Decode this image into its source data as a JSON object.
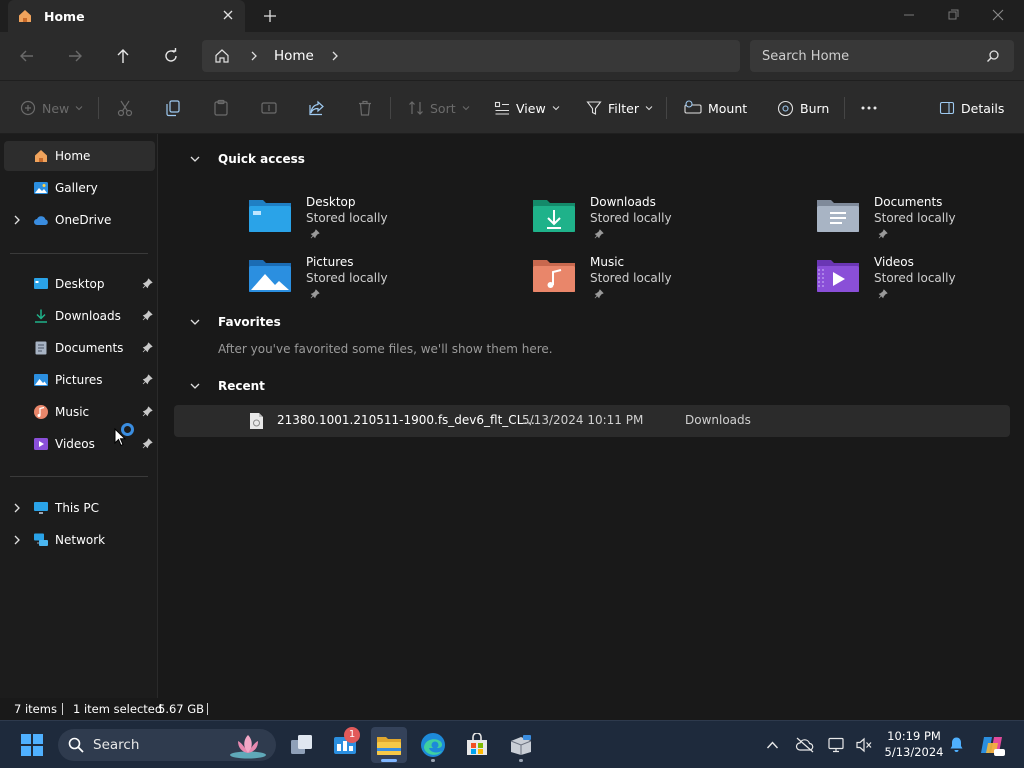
{
  "window": {
    "tab_label": "Home",
    "minimize": "Minimize",
    "maximize": "Maximize",
    "close": "Close"
  },
  "address": {
    "breadcrumb": "Home",
    "search_placeholder": "Search Home"
  },
  "toolbar": {
    "new_label": "New",
    "sort_label": "Sort",
    "view_label": "View",
    "filter_label": "Filter",
    "mount_label": "Mount",
    "burn_label": "Burn",
    "details_label": "Details"
  },
  "sidebar": {
    "top": [
      {
        "label": "Home"
      },
      {
        "label": "Gallery"
      },
      {
        "label": "OneDrive"
      }
    ],
    "pinned": [
      {
        "label": "Desktop"
      },
      {
        "label": "Downloads"
      },
      {
        "label": "Documents"
      },
      {
        "label": "Pictures"
      },
      {
        "label": "Music"
      },
      {
        "label": "Videos"
      }
    ],
    "bottom": [
      {
        "label": "This PC"
      },
      {
        "label": "Network"
      }
    ]
  },
  "main": {
    "quick_access_title": "Quick access",
    "quick_access": [
      {
        "name": "Desktop",
        "sub": "Stored locally",
        "icon": "desktop-folder-icon",
        "color": "#2aa3e8"
      },
      {
        "name": "Downloads",
        "sub": "Stored locally",
        "icon": "downloads-folder-icon",
        "color": "#1fb28a"
      },
      {
        "name": "Documents",
        "sub": "Stored locally",
        "icon": "documents-folder-icon",
        "color": "#a8b4c4"
      },
      {
        "name": "Pictures",
        "sub": "Stored locally",
        "icon": "pictures-folder-icon",
        "color": "#2b8fe0"
      },
      {
        "name": "Music",
        "sub": "Stored locally",
        "icon": "music-folder-icon",
        "color": "#e9866a"
      },
      {
        "name": "Videos",
        "sub": "Stored locally",
        "icon": "videos-folder-icon",
        "color": "#8a4fd8"
      }
    ],
    "favorites_title": "Favorites",
    "favorites_empty": "After you've favorited some files, we'll show them here.",
    "recent_title": "Recent",
    "recent": [
      {
        "name": "21380.1001.210511-1900.fs_dev6_flt_CL...",
        "date": "5/13/2024 10:11 PM",
        "location": "Downloads"
      }
    ]
  },
  "status": {
    "items": "7 items",
    "selected": "1 item selected",
    "size": "5.67 GB"
  },
  "taskbar": {
    "search_label": "Search",
    "badge_count": "1",
    "time": "10:19 PM",
    "date": "5/13/2024"
  },
  "colors": {
    "accent": "#3a8de0",
    "background": "#191919"
  }
}
